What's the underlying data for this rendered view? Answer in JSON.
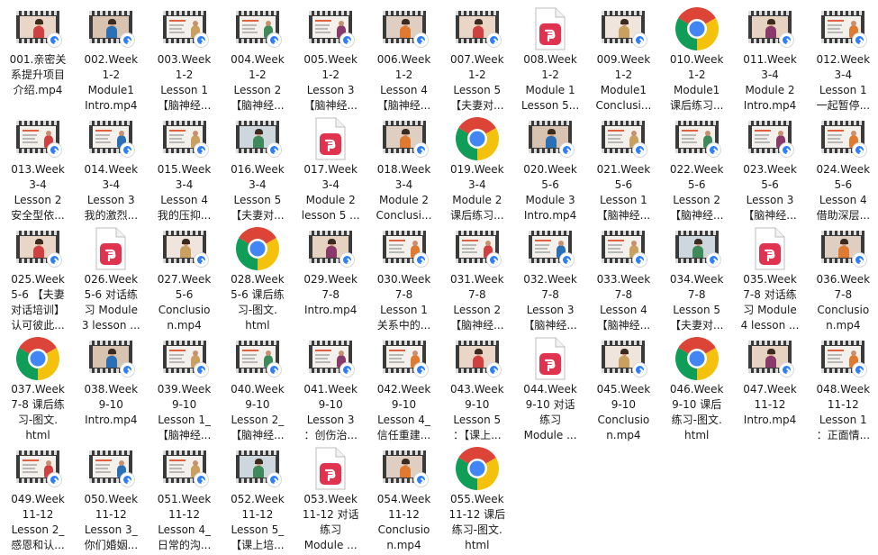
{
  "window_title": "",
  "items": [
    {
      "name": "001.亲密关系提升项目介绍.mp4",
      "label": "001.亲密关\n系提升项目\n介绍.mp4",
      "type": "video",
      "thumb": "person"
    },
    {
      "name": "002.Week 1-2 Module1 Intro.mp4",
      "label": "002.Week\n1-2\nModule1\nIntro.mp4",
      "type": "video",
      "thumb": "person"
    },
    {
      "name": "003.Week 1-2 Lesson 1【脑神经...",
      "label": "003.Week\n1-2\nLesson 1\n【脑神经...",
      "type": "video",
      "thumb": "slide"
    },
    {
      "name": "004.Week 1-2 Lesson 2【脑神经...",
      "label": "004.Week\n1-2\nLesson 2\n【脑神经...",
      "type": "video",
      "thumb": "slide"
    },
    {
      "name": "005.Week 1-2 Lesson 3【脑神经...",
      "label": "005.Week\n1-2\nLesson 3\n【脑神经...",
      "type": "video",
      "thumb": "slide"
    },
    {
      "name": "006.Week 1-2 Lesson 4【脑神经...",
      "label": "006.Week\n1-2\nLesson 4\n【脑神经...",
      "type": "video",
      "thumb": "person"
    },
    {
      "name": "007.Week 1-2 Lesson 5【夫妻对...",
      "label": "007.Week\n1-2\nLesson 5\n【夫妻对...",
      "type": "video",
      "thumb": "person"
    },
    {
      "name": "008.Week 1-2 Module 1 Lesson 5...",
      "label": "008.Week\n1-2\nModule 1\nLesson 5...",
      "type": "pdf"
    },
    {
      "name": "009.Week 1-2 Module1 Conclusi...",
      "label": "009.Week\n1-2\nModule1\nConclusi...",
      "type": "video",
      "thumb": "person"
    },
    {
      "name": "010.Week 1-2 Module1 课后练习...",
      "label": "010.Week\n1-2\nModule1\n课后练习...",
      "type": "chrome"
    },
    {
      "name": "011.Week 3-4 Module 2 Intro.mp4",
      "label": "011.Week\n3-4\nModule 2\nIntro.mp4",
      "type": "video",
      "thumb": "person"
    },
    {
      "name": "012.Week 3-4 Lesson 1 一起暂停...",
      "label": "012.Week\n3-4\nLesson 1\n一起暂停...",
      "type": "video",
      "thumb": "slide"
    },
    {
      "name": "013.Week 3-4 Lesson 2 安全型依...",
      "label": "013.Week\n3-4\nLesson  2\n安全型依...",
      "type": "video",
      "thumb": "slide"
    },
    {
      "name": "014.Week 3-4 Lesson 3 我的激烈...",
      "label": "014.Week\n3-4\nLesson 3\n我的激烈...",
      "type": "video",
      "thumb": "slide"
    },
    {
      "name": "015.Week 3-4 Lesson 4 我的压抑...",
      "label": "015.Week\n3-4\nLesson 4\n我的压抑...",
      "type": "video",
      "thumb": "slide"
    },
    {
      "name": "016.Week 3-4 Lesson 5【夫妻对...",
      "label": "016.Week\n3-4\nLesson 5\n【夫妻对...",
      "type": "video",
      "thumb": "person"
    },
    {
      "name": "017.Week 3-4 Module 2 lesson 5...",
      "label": "017.Week\n3-4\nModule 2\nlesson 5 ...",
      "type": "pdf"
    },
    {
      "name": "018.Week 3-4 Module 2 Conclusi...",
      "label": "018.Week\n3-4\nModule 2\nConclusi...",
      "type": "video",
      "thumb": "person"
    },
    {
      "name": "019.Week 3-4 Module 2 课后练习...",
      "label": "019.Week\n3-4\nModule 2\n课后练习...",
      "type": "chrome"
    },
    {
      "name": "020.Week 5-6 Module 3 Intro.mp4",
      "label": "020.Week\n5-6\nModule 3\nIntro.mp4",
      "type": "video",
      "thumb": "person"
    },
    {
      "name": "021.Week 5-6 Lesson 1【脑神经...",
      "label": "021.Week\n5-6\nLesson 1\n【脑神经...",
      "type": "video",
      "thumb": "slide"
    },
    {
      "name": "022.Week 5-6 Lesson 2【脑神经...",
      "label": "022.Week\n5-6\nLesson 2\n【脑神经...",
      "type": "video",
      "thumb": "slide"
    },
    {
      "name": "023.Week 5-6 Lesson 3【脑神经...",
      "label": "023.Week\n5-6\nLesson 3\n【脑神经...",
      "type": "video",
      "thumb": "slide"
    },
    {
      "name": "024.Week 5-6 Lesson 4 借助深层...",
      "label": "024.Week\n5-6\nLesson 4\n借助深层...",
      "type": "video",
      "thumb": "slide"
    },
    {
      "name": "025.Week 5-6【夫妻对话培训】认可彼此...",
      "label": "025.Week\n5-6 【夫妻\n对话培训】\n认可彼此...",
      "type": "video",
      "thumb": "person"
    },
    {
      "name": "026.Week 5-6 对话练习 Module 3 lesson ...",
      "label": "026.Week\n5-6 对话练\n习 Module\n3 lesson ...",
      "type": "pdf"
    },
    {
      "name": "027.Week 5-6 Conclusion.mp4",
      "label": "027.Week\n5-6\nConclusio\nn.mp4",
      "type": "video",
      "thumb": "person"
    },
    {
      "name": "028.Week 5-6 课后练习-图文.html",
      "label": "028.Week\n5-6 课后练\n习-图文.\nhtml",
      "type": "chrome"
    },
    {
      "name": "029.Week 7-8 Intro.mp4",
      "label": "029.Week\n7-8\nIntro.mp4",
      "type": "video",
      "thumb": "person"
    },
    {
      "name": "030.Week 7-8 Lesson 1 关系中的...",
      "label": "030.Week\n7-8\nLesson 1\n关系中的...",
      "type": "video",
      "thumb": "slide"
    },
    {
      "name": "031.Week 7-8 Lesson 2【脑神经...",
      "label": "031.Week\n7-8\nLesson 2\n【脑神经...",
      "type": "video",
      "thumb": "slide"
    },
    {
      "name": "032.Week 7-8 Lesson 3【脑神经...",
      "label": "032.Week\n7-8\nLesson 3\n【脑神经...",
      "type": "video",
      "thumb": "slide"
    },
    {
      "name": "033.Week 7-8 Lesson 4【脑神经...",
      "label": "033.Week\n7-8\nLesson 4\n【脑神经...",
      "type": "video",
      "thumb": "slide"
    },
    {
      "name": "034.Week 7-8 Lesson 5【夫妻对...",
      "label": "034.Week\n7-8\nLesson 5\n【夫妻对...",
      "type": "video",
      "thumb": "person"
    },
    {
      "name": "035.Week 7-8 对话练习 Module 4 lesson ...",
      "label": "035.Week\n7-8 对话练\n习 Module\n4 lesson ...",
      "type": "pdf"
    },
    {
      "name": "036.Week 7-8 Conclusion.mp4",
      "label": "036.Week\n7-8\nConclusio\nn.mp4",
      "type": "video",
      "thumb": "person"
    },
    {
      "name": "037.Week 7-8 课后练习-图文.html",
      "label": "037.Week\n7-8 课后练\n习-图文.\nhtml",
      "type": "chrome"
    },
    {
      "name": "038.Week 9-10 Intro.mp4",
      "label": "038.Week\n9-10\nIntro.mp4",
      "type": "video",
      "thumb": "person"
    },
    {
      "name": "039.Week 9-10 Lesson 1_【脑神经...",
      "label": "039.Week\n9-10\nLesson 1_\n【脑神经...",
      "type": "video",
      "thumb": "slide"
    },
    {
      "name": "040.Week 9-10 Lesson 2_【脑神经...",
      "label": "040.Week\n9-10\nLesson 2_\n【脑神经...",
      "type": "video",
      "thumb": "slide"
    },
    {
      "name": "041.Week 9-10 Lesson 3：创伤治...",
      "label": "041.Week\n9-10\nLesson 3\n：创伤治...",
      "type": "video",
      "thumb": "slide"
    },
    {
      "name": "042.Week 9-10 Lesson 4_信任重建...",
      "label": "042.Week\n9-10\nLesson 4_\n信任重建...",
      "type": "video",
      "thumb": "slide"
    },
    {
      "name": "043.Week 9-10 Lesson 5：【课上...",
      "label": "043.Week\n9-10\nLesson 5\n：【课上...",
      "type": "video",
      "thumb": "person"
    },
    {
      "name": "044.Week 9-10 对话练习 Module ...",
      "label": "044.Week\n9-10 对话\n练习\nModule ...",
      "type": "pdf"
    },
    {
      "name": "045.Week 9-10 Conclusion.mp4",
      "label": "045.Week\n9-10\nConclusio\nn.mp4",
      "type": "video",
      "thumb": "person"
    },
    {
      "name": "046.Week 9-10 课后练习-图文.html",
      "label": "046.Week\n9-10 课后\n练习-图文.\nhtml",
      "type": "chrome"
    },
    {
      "name": "047.Week 11-12 Intro.mp4",
      "label": "047.Week\n11-12\nIntro.mp4",
      "type": "video",
      "thumb": "person"
    },
    {
      "name": "048.Week 11-12 Lesson 1：正面情...",
      "label": "048.Week\n11-12\nLesson 1\n：正面情...",
      "type": "video",
      "thumb": "slide"
    },
    {
      "name": "049.Week 11-12 Lesson 2_感恩和认...",
      "label": "049.Week\n11-12\nLesson 2_\n感恩和认...",
      "type": "video",
      "thumb": "slide"
    },
    {
      "name": "050.Week 11-12 Lesson 3_你们婚姻...",
      "label": "050.Week\n11-12\nLesson 3_\n你们婚姻...",
      "type": "video",
      "thumb": "slide"
    },
    {
      "name": "051.Week 11-12 Lesson 4_日常的沟...",
      "label": "051.Week\n11-12\nLesson 4_\n日常的沟...",
      "type": "video",
      "thumb": "slide"
    },
    {
      "name": "052.Week 11-12 Lesson 5_【课上培...",
      "label": "052.Week\n11-12\nLesson 5_\n【课上培...",
      "type": "video",
      "thumb": "person"
    },
    {
      "name": "053.Week 11-12 对话练习 Module ...",
      "label": "053.Week\n11-12 对话\n练习\nModule ...",
      "type": "pdf"
    },
    {
      "name": "054.Week 11-12 Conclusion.mp4",
      "label": "054.Week\n11-12\nConclusio\nn.mp4",
      "type": "video",
      "thumb": "person"
    },
    {
      "name": "055.Week 11-12 课后练习-图文.html",
      "label": "055.Week\n11-12 课后\n练习-图文.\nhtml",
      "type": "chrome"
    }
  ],
  "colors": {
    "label_text": "#1a1a1a",
    "pdf_accent": "#e0334f",
    "badge_blue": "#2d7ff9",
    "chrome_red": "#db4437",
    "chrome_yellow": "#f4c20d",
    "chrome_green": "#0f9d58",
    "chrome_blue": "#4285f4"
  },
  "icons": {
    "video": "video-file-icon",
    "pdf": "pdf-file-icon",
    "chrome": "chrome-html-file-icon",
    "badge": "sync-badge-icon"
  }
}
